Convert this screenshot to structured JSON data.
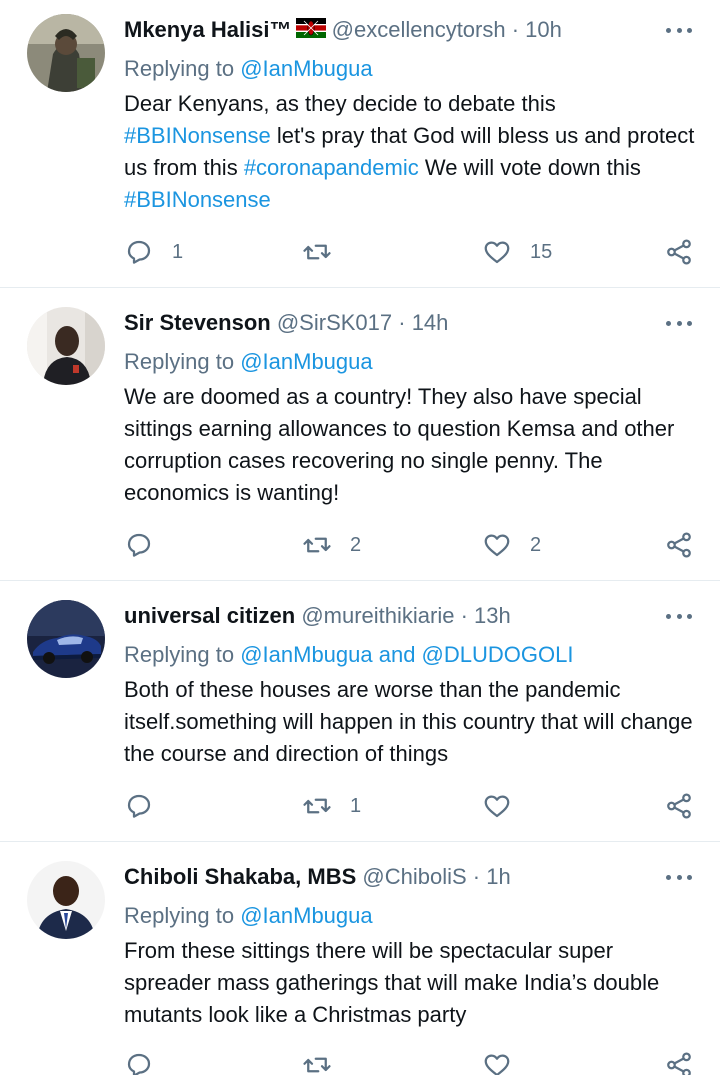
{
  "tweets": [
    {
      "name": "Mkenya Halisi™",
      "handle": "@excellencytorsh",
      "time": "10h",
      "replying_prefix": "Replying to",
      "replying_to": "@IanMbugua",
      "body_parts": [
        {
          "t": "Dear Kenyans, as they decide to debate this ",
          "tag": false
        },
        {
          "t": "#BBINonsense",
          "tag": true
        },
        {
          "t": "  let's pray that God will bless us and protect us from this ",
          "tag": false
        },
        {
          "t": "#coronapandemic",
          "tag": true
        },
        {
          "t": "  We will vote down this ",
          "tag": false
        },
        {
          "t": "#BBINonsense",
          "tag": true
        }
      ],
      "replies": "1",
      "retweets": "",
      "likes": "15"
    },
    {
      "name": "Sir Stevenson",
      "handle": "@SirSK017",
      "time": "14h",
      "replying_prefix": "Replying to",
      "replying_to": "@IanMbugua",
      "body_parts": [
        {
          "t": "We are doomed as a country! They also have special sittings earning allowances to question Kemsa and other corruption cases recovering no single penny. The economics is wanting!",
          "tag": false
        }
      ],
      "replies": "",
      "retweets": "2",
      "likes": "2"
    },
    {
      "name": "universal citizen",
      "handle": "@mureithikiarie",
      "time": "13h",
      "replying_prefix": "Replying to",
      "replying_to": "@IanMbugua and @DLUDOGOLI",
      "body_parts": [
        {
          "t": "Both of these houses are worse than the pandemic itself.something will happen in this country that will change the course and direction of things",
          "tag": false
        }
      ],
      "replies": "",
      "retweets": "1",
      "likes": ""
    },
    {
      "name": "Chiboli Shakaba, MBS",
      "handle": "@ChiboliS",
      "time": "1h",
      "replying_prefix": "Replying to",
      "replying_to": "@IanMbugua",
      "body_parts": [
        {
          "t": "From these sittings there will be spectacular super spreader mass gatherings that will make India’s double mutants look like a Christmas party",
          "tag": false
        }
      ],
      "replies": "",
      "retweets": "",
      "likes": ""
    }
  ],
  "separator": " · ",
  "colors": {
    "link": "#1b95e0",
    "secondary": "#5b7083",
    "divider": "#e6ecf0"
  },
  "icons": [
    "reply-icon",
    "retweet-icon",
    "like-icon",
    "share-icon",
    "more-icon",
    "kenya-flag-icon"
  ]
}
